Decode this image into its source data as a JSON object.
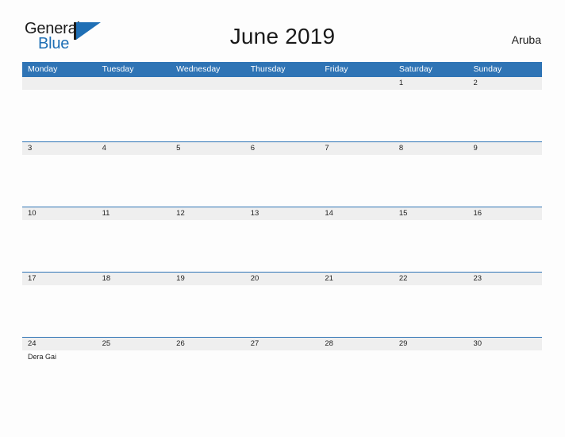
{
  "brand": {
    "name_part1": "General",
    "name_part2": "Blue",
    "flag_icon": "flag-icon"
  },
  "header": {
    "title": "June 2019",
    "locale": "Aruba"
  },
  "calendar": {
    "weekdays": [
      "Monday",
      "Tuesday",
      "Wednesday",
      "Thursday",
      "Friday",
      "Saturday",
      "Sunday"
    ],
    "weeks": [
      {
        "days": [
          {
            "num": "",
            "events": []
          },
          {
            "num": "",
            "events": []
          },
          {
            "num": "",
            "events": []
          },
          {
            "num": "",
            "events": []
          },
          {
            "num": "",
            "events": []
          },
          {
            "num": "1",
            "events": []
          },
          {
            "num": "2",
            "events": []
          }
        ]
      },
      {
        "days": [
          {
            "num": "3",
            "events": []
          },
          {
            "num": "4",
            "events": []
          },
          {
            "num": "5",
            "events": []
          },
          {
            "num": "6",
            "events": []
          },
          {
            "num": "7",
            "events": []
          },
          {
            "num": "8",
            "events": []
          },
          {
            "num": "9",
            "events": []
          }
        ]
      },
      {
        "days": [
          {
            "num": "10",
            "events": []
          },
          {
            "num": "11",
            "events": []
          },
          {
            "num": "12",
            "events": []
          },
          {
            "num": "13",
            "events": []
          },
          {
            "num": "14",
            "events": []
          },
          {
            "num": "15",
            "events": []
          },
          {
            "num": "16",
            "events": []
          }
        ]
      },
      {
        "days": [
          {
            "num": "17",
            "events": []
          },
          {
            "num": "18",
            "events": []
          },
          {
            "num": "19",
            "events": []
          },
          {
            "num": "20",
            "events": []
          },
          {
            "num": "21",
            "events": []
          },
          {
            "num": "22",
            "events": []
          },
          {
            "num": "23",
            "events": []
          }
        ]
      },
      {
        "days": [
          {
            "num": "24",
            "events": [
              "Dera Gai"
            ]
          },
          {
            "num": "25",
            "events": []
          },
          {
            "num": "26",
            "events": []
          },
          {
            "num": "27",
            "events": []
          },
          {
            "num": "28",
            "events": []
          },
          {
            "num": "29",
            "events": []
          },
          {
            "num": "30",
            "events": []
          }
        ]
      }
    ]
  },
  "colors": {
    "header_blue": "#2f74b5",
    "brand_blue": "#1f6fb5",
    "date_band": "#efefef",
    "page_bg": "#fdfdfd",
    "text_dark": "#1e1e1e"
  }
}
